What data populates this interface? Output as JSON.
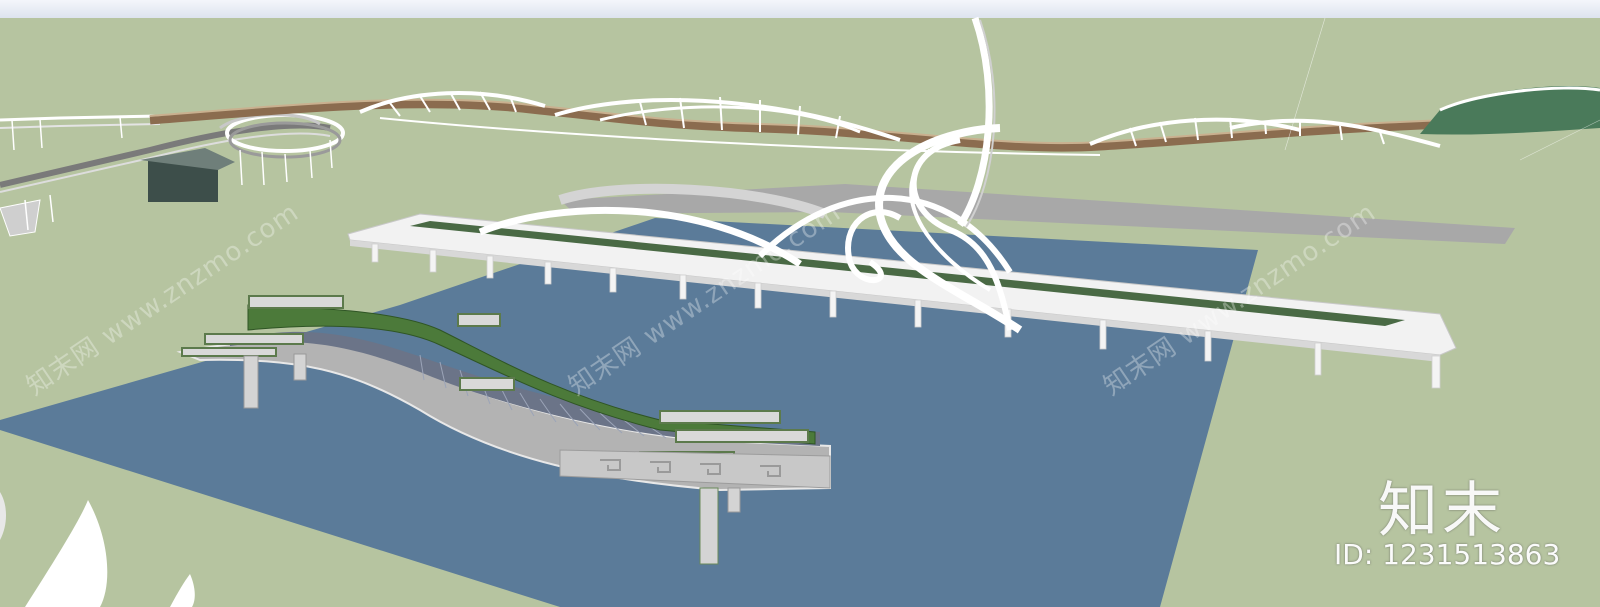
{
  "watermark": {
    "logo_text": "知末",
    "id_text": "ID: 1231513863",
    "diagonal_text": "知末网 www.znzmo.com"
  },
  "colors": {
    "ground": "#b6c4a0",
    "water": "#5a7a98",
    "deck_white": "#f2f2f2",
    "deck_gray": "#a9a9a9",
    "greenery": "#4d7a3a",
    "rail_brown": "#8a6a4c"
  }
}
